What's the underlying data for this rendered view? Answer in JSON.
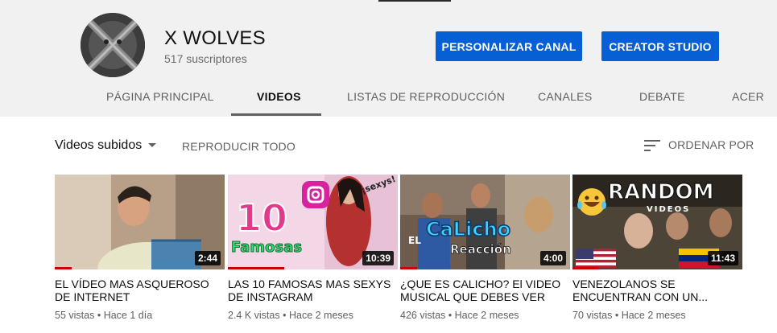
{
  "channel": {
    "name": "X WOLVES",
    "subscribers": "517 suscriptores",
    "customize_label": "PERSONALIZAR CANAL",
    "studio_label": "CREATOR STUDIO"
  },
  "tabs": [
    {
      "label": "PÁGINA PRINCIPAL"
    },
    {
      "label": "VIDEOS",
      "active": true
    },
    {
      "label": "LISTAS DE REPRODUCCIÓN"
    },
    {
      "label": "CANALES"
    },
    {
      "label": "DEBATE"
    },
    {
      "label": "ACER"
    }
  ],
  "toolbar": {
    "section": "Videos subidos",
    "play_all": "REPRODUCIR TODO",
    "sort": "ORDENAR POR"
  },
  "videos": [
    {
      "title": "EL VÍDEO MAS ASQUEROSO DE INTERNET",
      "duration": "2:44",
      "views": "55 vistas",
      "age": "Hace 1 día",
      "watched_fraction": 0.1
    },
    {
      "title": "LAS 10 FAMOSAS MAS SEXYS DE INSTAGRAM",
      "duration": "10:39",
      "views": "2.4 K vistas",
      "age": "Hace 2 meses",
      "thumb_text": {
        "number": "10",
        "word": "Famosas",
        "tag": "¡sexys!"
      },
      "watched_fraction": 0.33
    },
    {
      "title": "¿QUE ES CALICHO? El VIDEO MUSICAL QUE DEBES VER",
      "duration": "4:00",
      "views": "426 vistas",
      "age": "Hace 2 meses",
      "thumb_text": {
        "prefix": "EL",
        "word": "CaLicho",
        "sub": "Reacción"
      },
      "watched_fraction": 0.1
    },
    {
      "title": "VENEZOLANOS SE ENCUENTRAN CON UN...",
      "duration": "11:43",
      "views": "70 vistas",
      "age": "Hace 2 meses",
      "thumb_text": {
        "word": "RANDOM",
        "sub": "VIDEOS"
      },
      "watched_fraction": 0.15
    }
  ],
  "colors": {
    "primary_button": "#065fd4",
    "header_bg": "#f1f1f1",
    "progress": "#cc0000"
  }
}
